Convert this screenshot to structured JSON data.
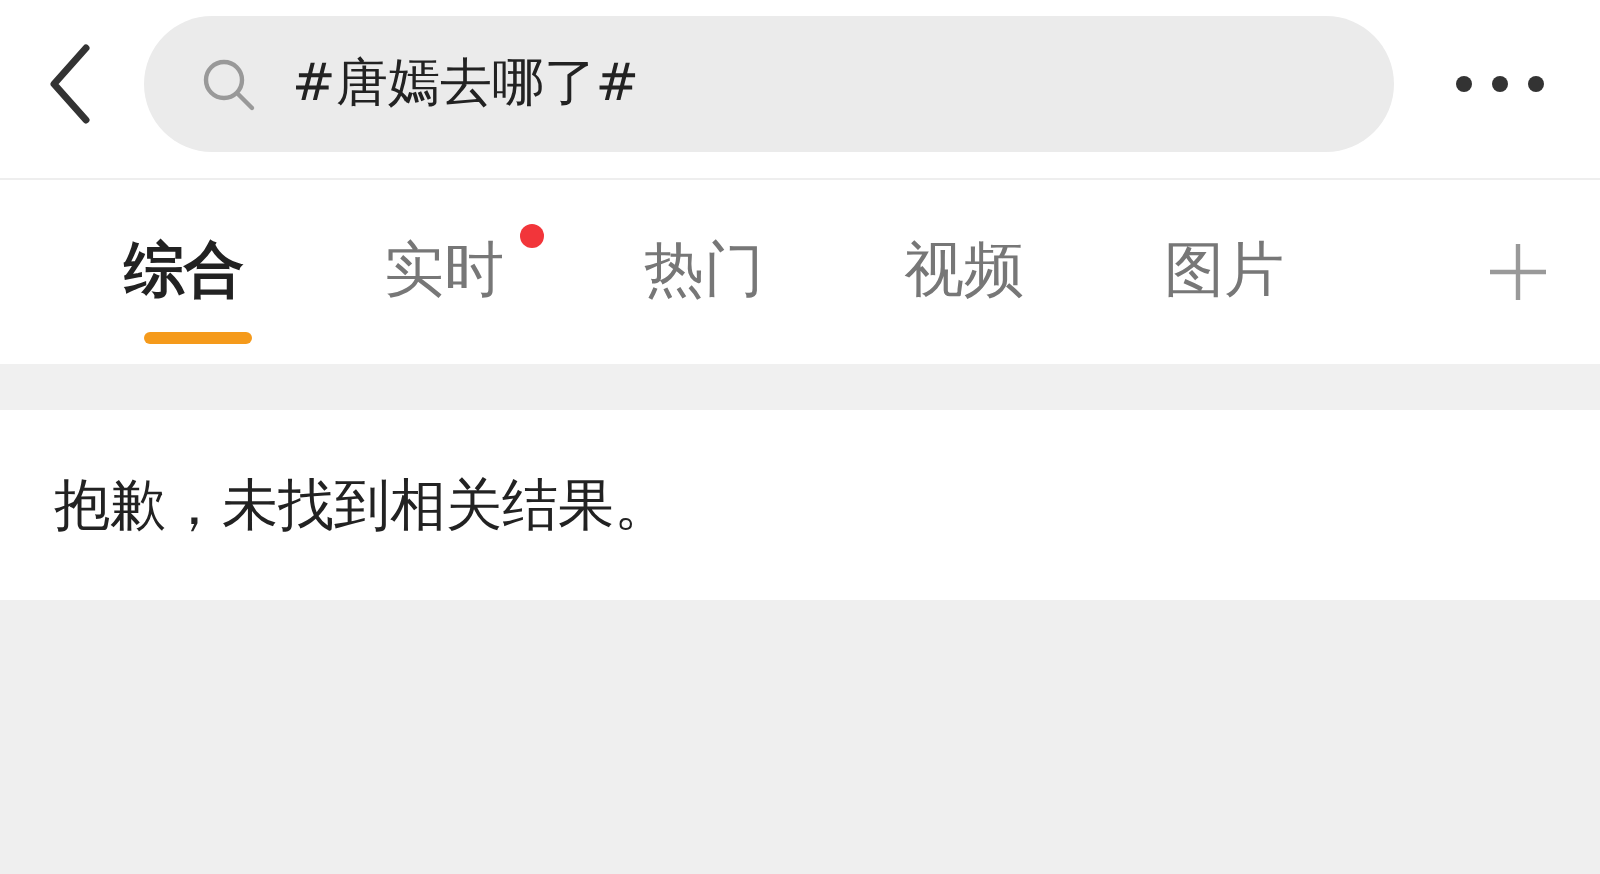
{
  "search": {
    "value": "#唐嫣去哪了#"
  },
  "tabs": [
    {
      "label": "综合",
      "selected": true,
      "dot": false
    },
    {
      "label": "实时",
      "selected": false,
      "dot": true
    },
    {
      "label": "热门",
      "selected": false,
      "dot": false
    },
    {
      "label": "视频",
      "selected": false,
      "dot": false
    },
    {
      "label": "图片",
      "selected": false,
      "dot": false
    }
  ],
  "result": {
    "message": "抱歉，未找到相关结果。"
  }
}
